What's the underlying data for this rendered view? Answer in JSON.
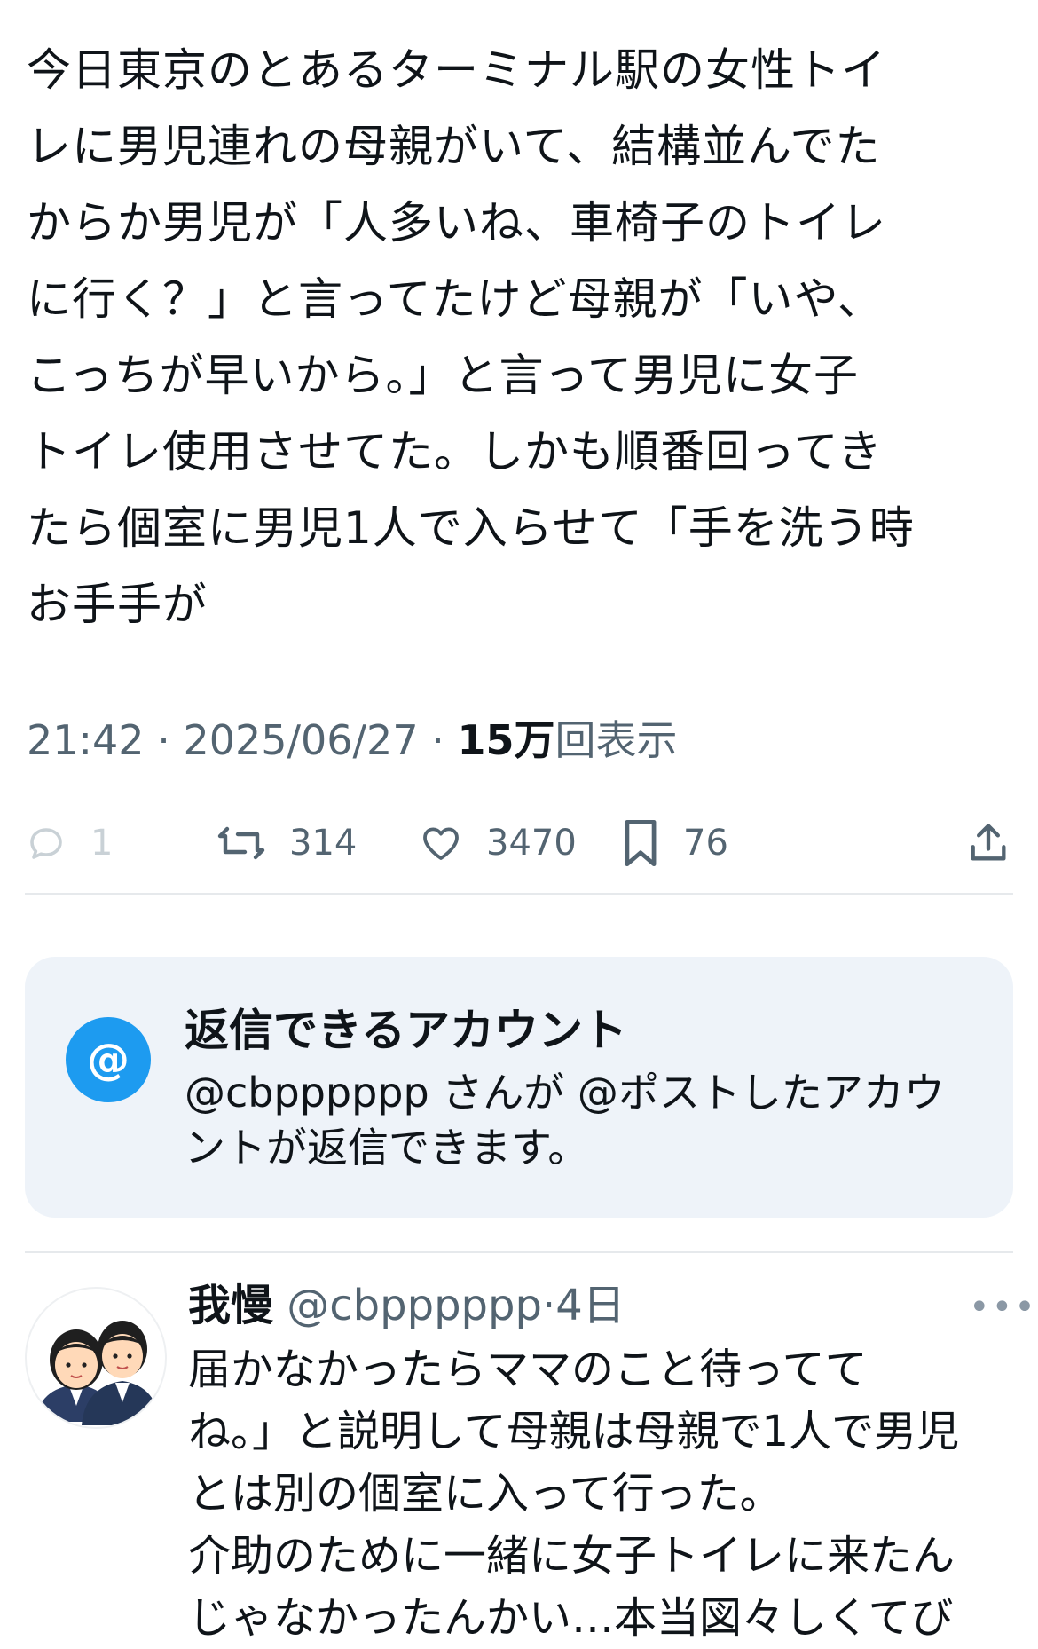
{
  "post": {
    "text": "今日東京のとあるターミナル駅の女性トイ\nレに男児連れの母親がいて、結構並んでた\nからか男児が「人多いね、車椅子のトイレ\nに行く？」と言ってたけど母親が「いや、\nこっちが早いから。」と言って男児に女子\nトイレ使用させてた。しかも順番回ってき\nたら個室に男児1人で入らせて「手を洗う時\nお手手が",
    "time": "21:42",
    "date": "2025/06/27",
    "views_count": "15万",
    "views_label": "回表示"
  },
  "actions": {
    "replies": "1",
    "reposts": "314",
    "likes": "3470",
    "bookmarks": "76"
  },
  "reply_notice": {
    "title": "返信できるアカウント",
    "body": "@cbpppppp さんが @ポストしたアカウントが返信できます。"
  },
  "reply": {
    "name": "我慢",
    "handle": "@cbpppppp",
    "time": "4日",
    "more": "•••",
    "text": "届かなかったらママのこと待ってて\nね。」と説明して母親は母親で1人で男児\nとは別の個室に入って行った。\n介助のために一緒に女子トイレに来たん\nじゃなかったんかい…本当図々しくてび"
  },
  "colors": {
    "text": "#0f1419",
    "secondary": "#536471",
    "accent": "#1d9bf0",
    "notice_bg": "#eef3f9",
    "divider": "#e6e9ec"
  },
  "icons": [
    "reply-icon",
    "repost-icon",
    "like-icon",
    "bookmark-icon",
    "share-icon",
    "at-icon",
    "avatar-image"
  ]
}
